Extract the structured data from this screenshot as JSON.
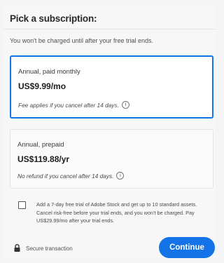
{
  "header": {
    "title": "Pick a subscription:",
    "subtitle": "You won't be charged until after your free trial ends."
  },
  "plans": [
    {
      "name": "Annual, paid monthly",
      "price": "US$9.99/mo",
      "note": "Fee applies if you cancel after 14 days.",
      "selected": true
    },
    {
      "name": "Annual, prepaid",
      "price": "US$119.88/yr",
      "note": "No refund if you cancel after 14 days.",
      "selected": false
    }
  ],
  "trial": {
    "checked": false,
    "text": "Add a 7-day free trial of Adobe Stock and get up to 10 standard assets. Cancel risk-free before your trial ends, and you won't be charged. Pay US$29.99/mo after your trial ends."
  },
  "footer": {
    "secure_label": "Secure transaction",
    "continue_label": "Continue"
  },
  "colors": {
    "accent": "#1473e6"
  },
  "icons": {
    "info": "info-icon",
    "lock": "lock-icon",
    "checkbox": "checkbox-icon"
  }
}
